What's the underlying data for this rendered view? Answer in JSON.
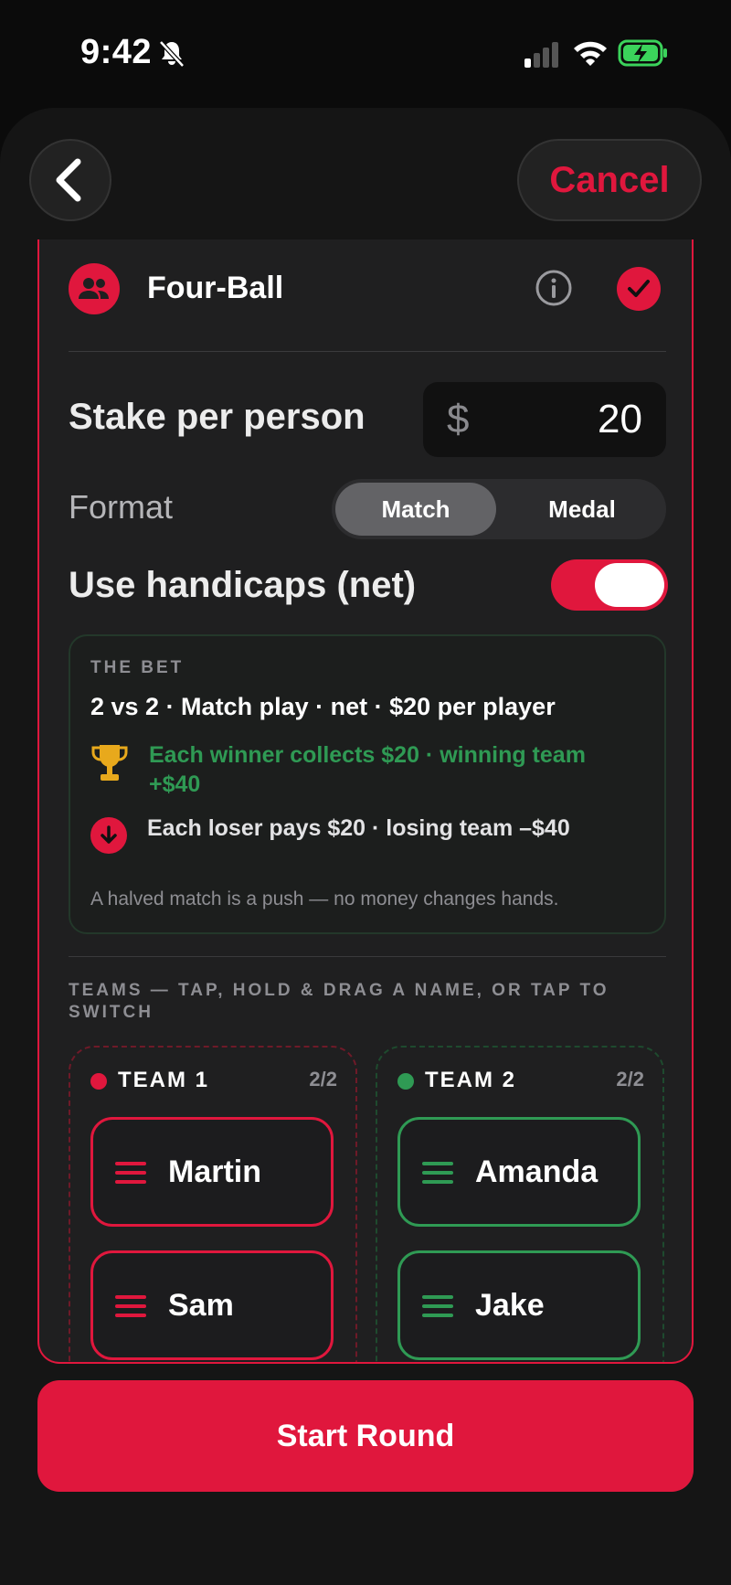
{
  "status": {
    "time": "9:42"
  },
  "nav": {
    "cancel_label": "Cancel"
  },
  "game": {
    "title": "Four-Ball"
  },
  "stake": {
    "label": "Stake per person",
    "currency": "$",
    "value": "20"
  },
  "format": {
    "label": "Format",
    "options": [
      "Match",
      "Medal"
    ],
    "selected": "Match"
  },
  "handicap": {
    "label": "Use handicaps (net)",
    "enabled": true
  },
  "bet": {
    "heading": "THE BET",
    "summary": "2 vs 2 · Match play · net · $20 per player",
    "win": "Each winner collects $20  ·  winning team +$40",
    "lose": "Each loser pays $20  ·  losing team –$40",
    "push": "A halved match is a push — no money changes hands."
  },
  "teams_heading": "TEAMS — TAP, HOLD & DRAG A NAME, OR TAP TO SWITCH",
  "teams": [
    {
      "name": "TEAM 1",
      "count": "2/2",
      "color": "#e0173d",
      "players": [
        "Martin",
        "Sam"
      ]
    },
    {
      "name": "TEAM 2",
      "count": "2/2",
      "color": "#2f9a54",
      "players": [
        "Amanda",
        "Jake"
      ]
    }
  ],
  "start_label": "Start Round",
  "colors": {
    "accent": "#e0173d",
    "win": "#2f9a54",
    "background": "#0b0b0b"
  }
}
